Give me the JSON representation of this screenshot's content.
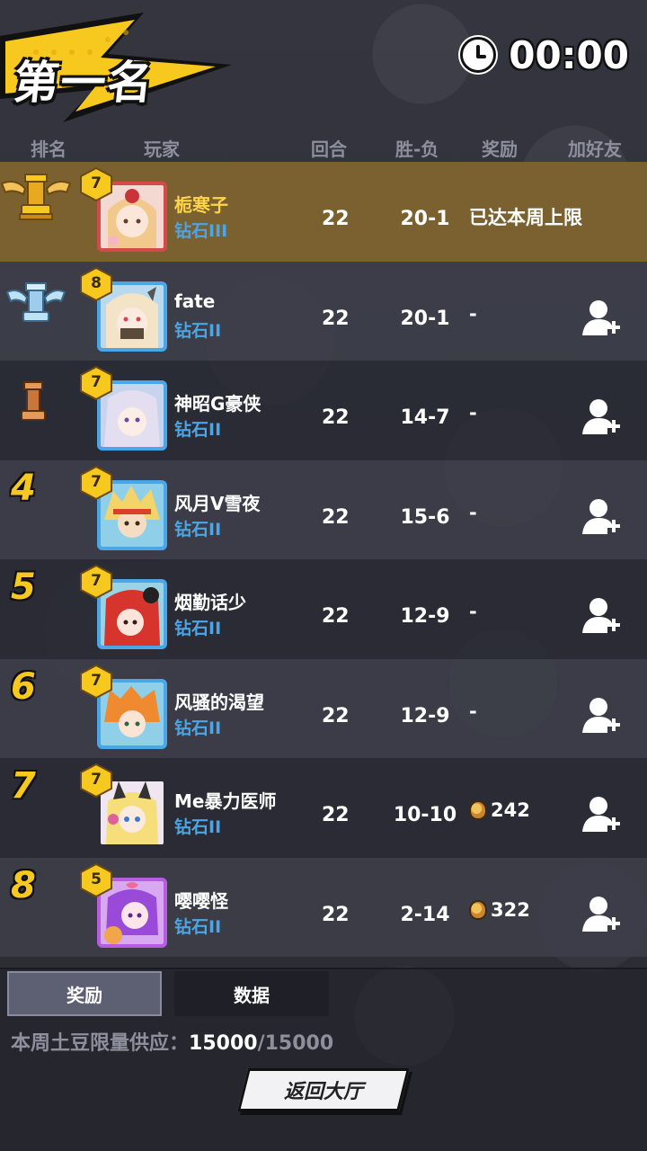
{
  "header": {
    "title": "第一名",
    "timer": "00:00"
  },
  "columns": {
    "rank": "排名",
    "player": "玩家",
    "rounds": "回合",
    "win_loss": "胜-负",
    "reward": "奖励",
    "add_friend": "加好友"
  },
  "colors": {
    "accent_yellow": "#f7c81d",
    "tier_blue": "#4aa6e6",
    "highlight_row": "#7b6130",
    "muted_text": "#8d8f9c"
  },
  "players": [
    {
      "rank": "1",
      "rank_icon": "gold-trophy-icon",
      "level": "7",
      "name": "栀寒子",
      "tier": "钻石III",
      "rounds": "22",
      "win_loss": "20-1",
      "reward": "已达本周上限",
      "reward_icon": "",
      "add_friend": false,
      "is_me": true
    },
    {
      "rank": "2",
      "rank_icon": "silver-trophy-icon",
      "level": "8",
      "name": "fate",
      "tier": "钻石II",
      "rounds": "22",
      "win_loss": "20-1",
      "reward": "-",
      "reward_icon": "",
      "add_friend": true,
      "is_me": false
    },
    {
      "rank": "3",
      "rank_icon": "bronze-trophy-icon",
      "level": "7",
      "name": "神昭G豪侠",
      "tier": "钻石II",
      "rounds": "22",
      "win_loss": "14-7",
      "reward": "-",
      "reward_icon": "",
      "add_friend": true,
      "is_me": false
    },
    {
      "rank": "4",
      "rank_icon": "",
      "level": "7",
      "name": "风月V雪夜",
      "tier": "钻石II",
      "rounds": "22",
      "win_loss": "15-6",
      "reward": "-",
      "reward_icon": "",
      "add_friend": true,
      "is_me": false
    },
    {
      "rank": "5",
      "rank_icon": "",
      "level": "7",
      "name": "烟勤话少",
      "tier": "钻石II",
      "rounds": "22",
      "win_loss": "12-9",
      "reward": "-",
      "reward_icon": "",
      "add_friend": true,
      "is_me": false
    },
    {
      "rank": "6",
      "rank_icon": "",
      "level": "7",
      "name": "风骚的渴望",
      "tier": "钻石II",
      "rounds": "22",
      "win_loss": "12-9",
      "reward": "-",
      "reward_icon": "",
      "add_friend": true,
      "is_me": false
    },
    {
      "rank": "7",
      "rank_icon": "",
      "level": "7",
      "name": "Me暴力医师",
      "tier": "钻石II",
      "rounds": "22",
      "win_loss": "10-10",
      "reward": "242",
      "reward_icon": "potato-icon",
      "add_friend": true,
      "is_me": false
    },
    {
      "rank": "8",
      "rank_icon": "",
      "level": "5",
      "name": "嘤嘤怪",
      "tier": "钻石II",
      "rounds": "22",
      "win_loss": "2-14",
      "reward": "322",
      "reward_icon": "potato-icon",
      "add_friend": true,
      "is_me": false
    }
  ],
  "tabs": [
    "奖励",
    "数据"
  ],
  "supply": {
    "label": "本周土豆限量供应：",
    "current": "15000",
    "max": "/15000"
  },
  "back_button": "返回大厅"
}
